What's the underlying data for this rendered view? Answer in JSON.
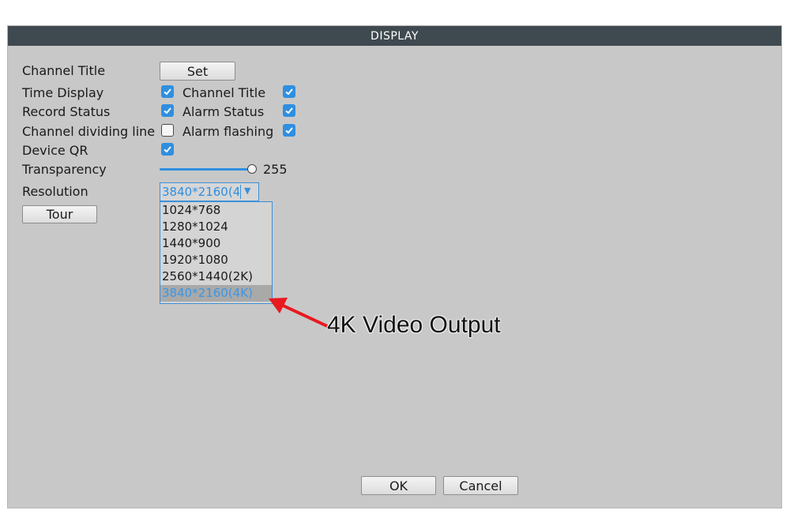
{
  "window": {
    "title": "DISPLAY"
  },
  "labels": {
    "channel_title": "Channel Title",
    "time_display": "Time Display",
    "record_status": "Record Status",
    "channel_dividing_line": "Channel dividing line",
    "device_qr": "Device QR",
    "transparency": "Transparency",
    "resolution": "Resolution",
    "channel_title_right": "Channel Title",
    "alarm_status": "Alarm Status",
    "alarm_flashing": "Alarm flashing"
  },
  "buttons": {
    "set": "Set",
    "tour": "Tour",
    "ok": "OK",
    "cancel": "Cancel"
  },
  "checkboxes": {
    "time_display": true,
    "channel_title": true,
    "record_status": true,
    "alarm_status": true,
    "channel_dividing_line": false,
    "alarm_flashing": true,
    "device_qr": true
  },
  "transparency": {
    "value": "255",
    "fraction": 1.0
  },
  "resolution": {
    "selected": "3840*2160(4K)",
    "options": [
      "1024*768",
      "1280*1024",
      "1440*900",
      "1920*1080",
      "2560*1440(2K)",
      "3840*2160(4K)"
    ]
  },
  "annotation": {
    "text": "4K Video Output",
    "arrow_color": "#e8191f"
  },
  "colors": {
    "accent": "#2f8fe0",
    "titlebar": "#3f4a50",
    "panel": "#c8c8c8"
  }
}
